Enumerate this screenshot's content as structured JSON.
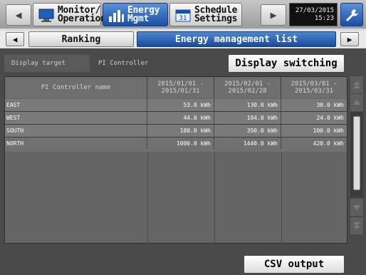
{
  "header": {
    "menu": [
      {
        "icon": "monitor-icon",
        "label_line1": "Monitor/",
        "label_line2": "Operation"
      },
      {
        "icon": "energy-chart-icon",
        "label_line1": "Energy",
        "label_line2": "Mgmt"
      },
      {
        "icon": "calendar-icon",
        "label_line1": "Schedule",
        "label_line2": "Settings"
      }
    ],
    "date": "27/03/2015",
    "time": "15:23"
  },
  "tabs": {
    "ranking": "Ranking",
    "energy_list": "Energy management list"
  },
  "display": {
    "target_label": "Display target",
    "target_value": "PI Controller",
    "switch_button": "Display switching"
  },
  "table": {
    "columns": [
      {
        "line1": "PI Controller name",
        "line2": ""
      },
      {
        "line1": "2015/01/01 -",
        "line2": "2015/01/31"
      },
      {
        "line1": "2015/02/01 -",
        "line2": "2015/02/28"
      },
      {
        "line1": "2015/03/01 -",
        "line2": "2015/03/31"
      }
    ],
    "rows": [
      {
        "name": "EAST",
        "values": [
          "53.0 kWh",
          "130.0 kWh",
          "30.0 kWh"
        ]
      },
      {
        "name": "WEST",
        "values": [
          "44.0 kWh",
          "104.0 kWh",
          "24.0 kWh"
        ]
      },
      {
        "name": "SOUTH",
        "values": [
          "180.0 kWh",
          "350.0 kWh",
          "100.0 kWh"
        ]
      },
      {
        "name": "NORTH",
        "values": [
          "1000.0 kWh",
          "1440.0 kWh",
          "420.0 kWh"
        ]
      }
    ]
  },
  "footer": {
    "csv_button": "CSV output"
  },
  "colors": {
    "accent_blue": "#1b4fa5",
    "panel_bg": "#4a4a4a"
  }
}
